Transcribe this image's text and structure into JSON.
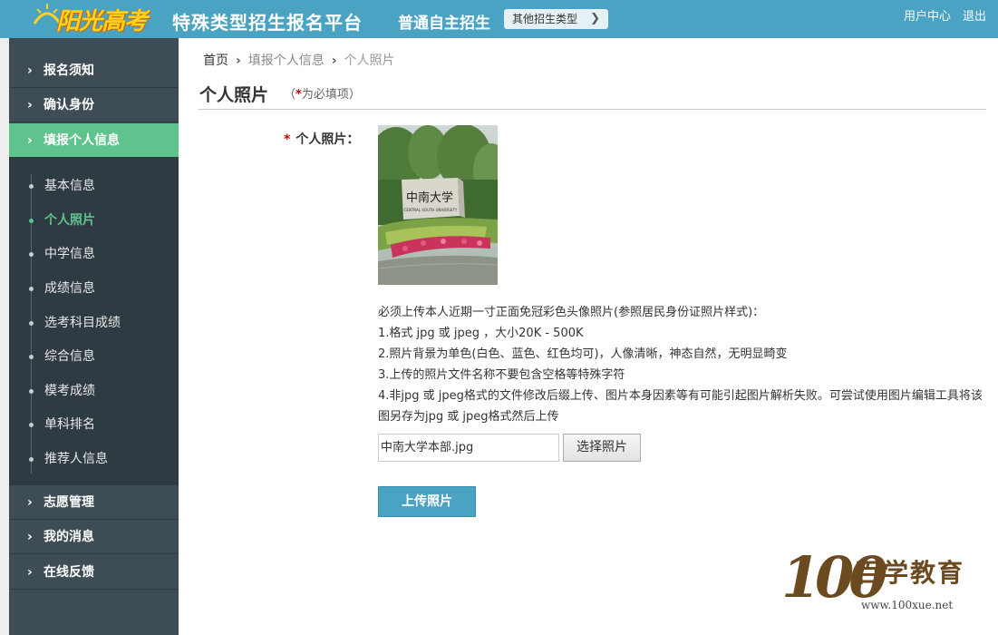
{
  "header": {
    "logo_text": "阳光高考",
    "platform_title": "特殊类型招生报名平台",
    "sub_title": "普通自主招生",
    "other_type_button": "其他招生类型",
    "user_center": "用户中心",
    "logout": "退出",
    "bg_color": "#4aa3c3"
  },
  "sidebar": {
    "groups_top": [
      {
        "label": "报名须知",
        "active": false
      },
      {
        "label": "确认身份",
        "active": false
      },
      {
        "label": "填报个人信息",
        "active": true
      }
    ],
    "sub_items": [
      {
        "label": "基本信息",
        "active": false
      },
      {
        "label": "个人照片",
        "active": true
      },
      {
        "label": "中学信息",
        "active": false
      },
      {
        "label": "成绩信息",
        "active": false
      },
      {
        "label": "选考科目成绩",
        "active": false
      },
      {
        "label": "综合信息",
        "active": false
      },
      {
        "label": "模考成绩",
        "active": false
      },
      {
        "label": "单科排名",
        "active": false
      },
      {
        "label": "推荐人信息",
        "active": false
      }
    ],
    "groups_bottom": [
      {
        "label": "志愿管理",
        "active": false
      },
      {
        "label": "我的消息",
        "active": false
      },
      {
        "label": "在线反馈",
        "active": false
      }
    ],
    "active_color": "#5ec38d"
  },
  "breadcrumb": {
    "home": "首页",
    "parent": "填报个人信息",
    "current": "个人照片"
  },
  "page": {
    "title": "个人照片",
    "required_open": "（",
    "required_star": "*",
    "required_text": "为必填项",
    "required_close": "）"
  },
  "form": {
    "photo_label": "个人照片：",
    "required_star": "*",
    "instructions": [
      "必须上传本人近期一寸正面免冠彩色头像照片(参照居民身份证照片样式)：",
      "1.格式 jpg 或 jpeg ，大小20K - 500K",
      "2.照片背景为单色(白色、蓝色、红色均可)，人像清晰，神态自然，无明显畸变",
      "3.上传的照片文件名称不要包含空格等特殊字符",
      "4.非jpg 或 jpeg格式的文件修改后缀上传、图片本身因素等有可能引起图片解析失败。可尝试使用图片编辑工具将该图另存为jpg 或 jpeg格式然后上传"
    ],
    "file_value": "中南大学本部.jpg",
    "choose_button": "选择照片",
    "upload_button": "上传照片"
  },
  "photo": {
    "sign_text": "中南大学",
    "sign_subtext": "CENTRAL SOUTH UNIVERSITY"
  },
  "watermark": {
    "number": "100",
    "brand": "百学教育",
    "url": "www.100xue.net"
  }
}
